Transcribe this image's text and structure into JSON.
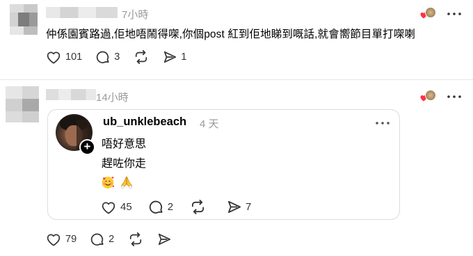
{
  "comment1": {
    "time": "7小時",
    "text": "仲係園賓路過,佢地唔鬧得㗎,你個post 紅到佢地睇到嘅話,就會嚮節目單打㗎喇",
    "like_count": "101",
    "reply_count": "3",
    "share_count": "1"
  },
  "comment2": {
    "time": "14小時",
    "like_count": "79",
    "reply_count": "2"
  },
  "quote": {
    "username": "ub_unklebeach",
    "time": "4 天",
    "lines": [
      "唔好意思",
      "趕咗你走"
    ],
    "emoji": [
      "smiling-face-with-hearts",
      "folded-hands"
    ],
    "like_count": "45",
    "reply_count": "2",
    "share_count": "7"
  },
  "icons": {
    "like": "heart-outline-icon",
    "reply": "speech-bubble-icon",
    "repost": "repost-arrows-icon",
    "share": "send-arrow-icon",
    "more": "three-dots-icon",
    "liked_by_author": "red-heart-with-avatar-icon"
  },
  "colors": {
    "text": "#000000",
    "muted": "#999999",
    "divider": "#e5e5e5",
    "heart_red": "#ff3040"
  }
}
